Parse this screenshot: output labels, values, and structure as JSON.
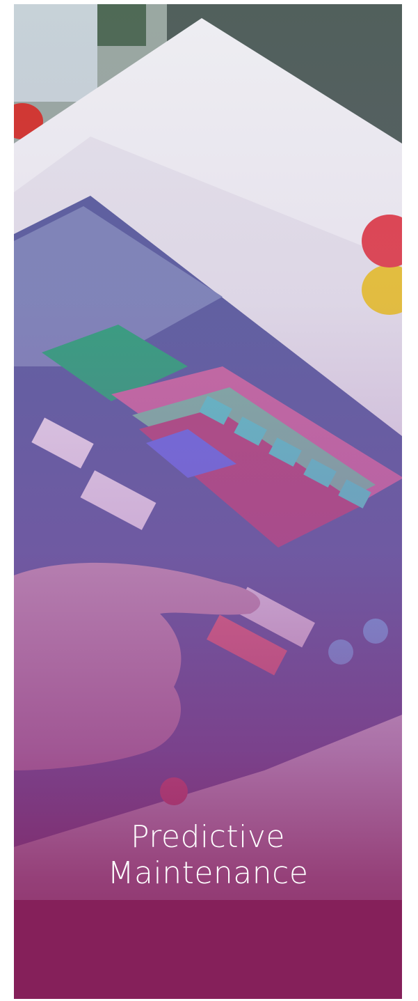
{
  "card": {
    "title_line1": "Predictive",
    "title_line2": "Maintenance"
  },
  "colors": {
    "band": "#85205a",
    "overlay_top": "#a06ebe",
    "overlay_bottom": "#82205a",
    "title_text": "#ffffff"
  }
}
